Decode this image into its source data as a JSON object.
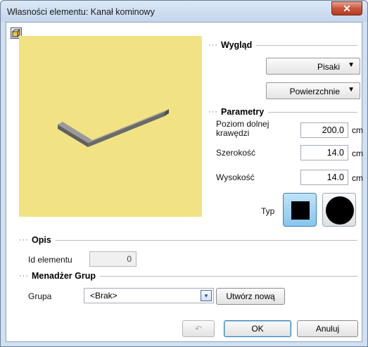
{
  "window": {
    "title": "Własności elementu: Kanał kominowy",
    "close_glyph": "✕"
  },
  "preview": {
    "background": "#f1e383",
    "view_toggle_icon": "cube-icon"
  },
  "appearance": {
    "header": "Wygląd",
    "pens_label": "Pisaki",
    "surfaces_label": "Powierzchnie"
  },
  "parameters": {
    "header": "Parametry",
    "bottom_edge_label": "Poziom dolnej krawędzi",
    "bottom_edge_value": "200.0",
    "width_label": "Szerokość",
    "width_value": "14.0",
    "height_label": "Wysokość",
    "height_value": "14.0",
    "unit": "cm",
    "type_label": "Typ",
    "type_options": [
      "square",
      "circle"
    ],
    "type_selected": "square"
  },
  "description": {
    "header": "Opis",
    "id_label": "Id elementu",
    "id_value": "0"
  },
  "group_manager": {
    "header": "Menadżer Grup",
    "group_label": "Grupa",
    "group_value": "<Brak>",
    "create_new_label": "Utwórz nową"
  },
  "footer": {
    "undo_icon": "undo-icon",
    "ok_label": "OK",
    "cancel_label": "Anuluj"
  }
}
